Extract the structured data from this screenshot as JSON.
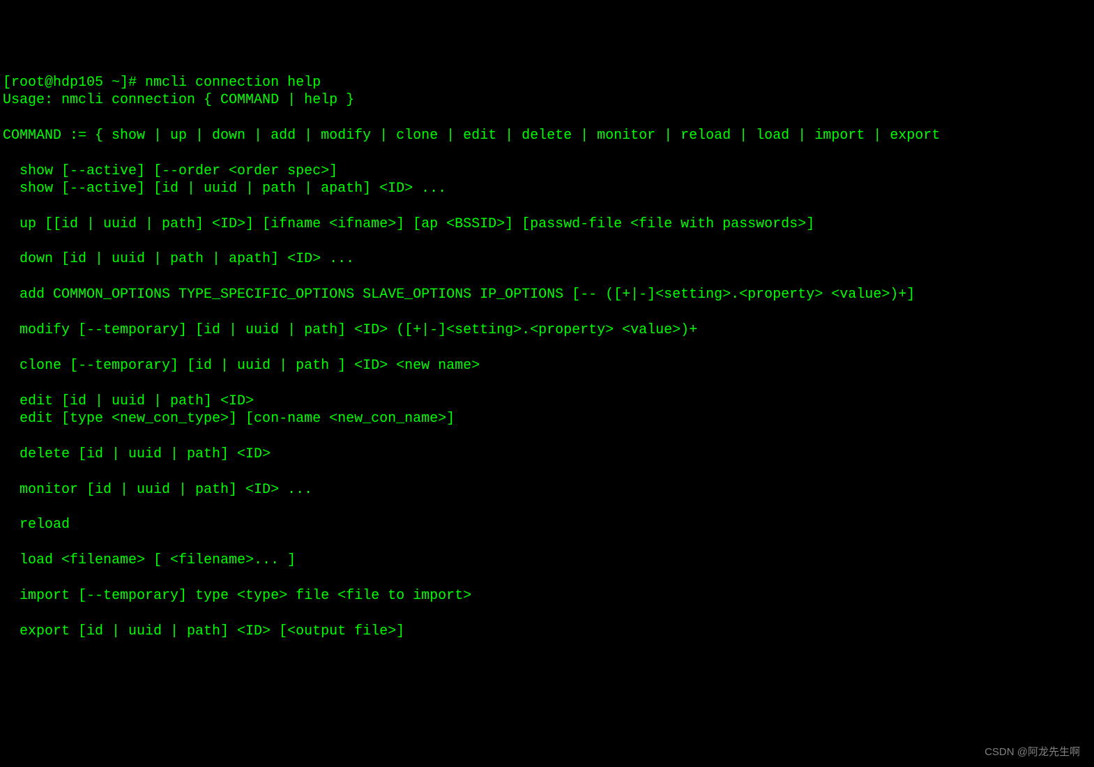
{
  "terminal": {
    "prompt_line": "[root@hdp105 ~]# nmcli connection help",
    "usage_line": "Usage: nmcli connection { COMMAND | help }",
    "command_def": "COMMAND := { show | up | down | add | modify | clone | edit | delete | monitor | reload | load | import | export",
    "show_line1": "  show [--active] [--order <order spec>]",
    "show_line2": "  show [--active] [id | uuid | path | apath] <ID> ...",
    "up_line": "  up [[id | uuid | path] <ID>] [ifname <ifname>] [ap <BSSID>] [passwd-file <file with passwords>]",
    "down_line": "  down [id | uuid | path | apath] <ID> ...",
    "add_line": "  add COMMON_OPTIONS TYPE_SPECIFIC_OPTIONS SLAVE_OPTIONS IP_OPTIONS [-- ([+|-]<setting>.<property> <value>)+]",
    "modify_line": "  modify [--temporary] [id | uuid | path] <ID> ([+|-]<setting>.<property> <value>)+",
    "clone_line": "  clone [--temporary] [id | uuid | path ] <ID> <new name>",
    "edit_line1": "  edit [id | uuid | path] <ID>",
    "edit_line2": "  edit [type <new_con_type>] [con-name <new_con_name>]",
    "delete_line": "  delete [id | uuid | path] <ID>",
    "monitor_line": "  monitor [id | uuid | path] <ID> ...",
    "reload_line": "  reload",
    "load_line": "  load <filename> [ <filename>... ]",
    "import_line": "  import [--temporary] type <type> file <file to import>",
    "export_line": "  export [id | uuid | path] <ID> [<output file>]"
  },
  "watermark": "CSDN @阿龙先生啊"
}
